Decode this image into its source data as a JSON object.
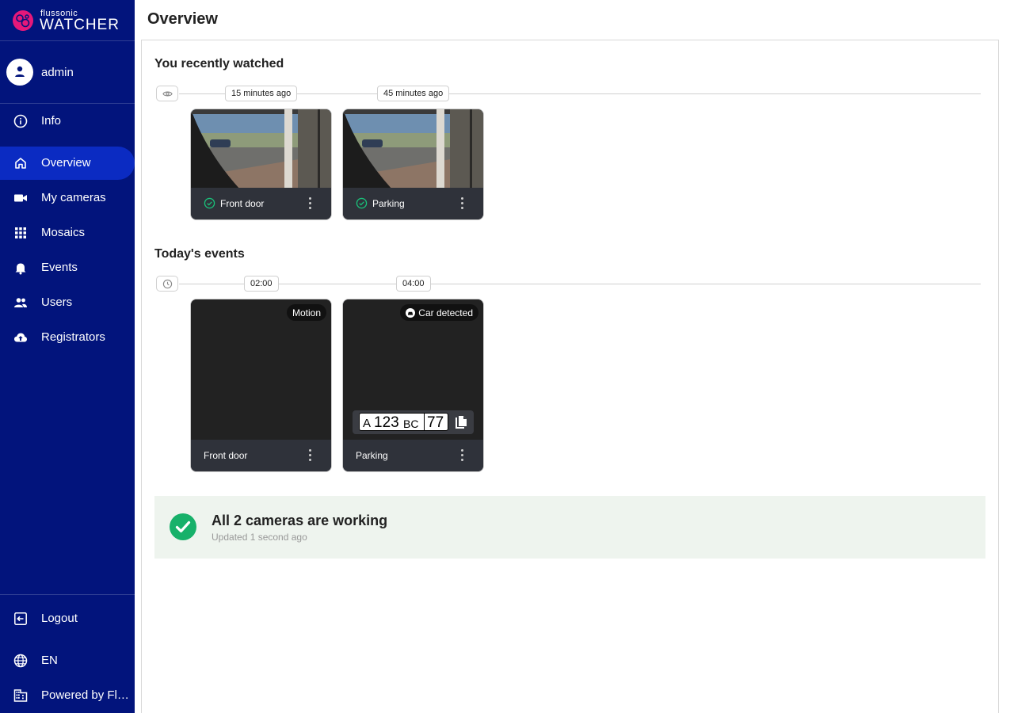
{
  "brand": {
    "small": "flussonic",
    "big": "WATCHER",
    "color": "#e6187a"
  },
  "user": {
    "name": "admin"
  },
  "nav": {
    "info": "Info",
    "overview": "Overview",
    "my_cameras": "My cameras",
    "mosaics": "Mosaics",
    "events": "Events",
    "users": "Users",
    "registrators": "Registrators",
    "logout": "Logout",
    "language": "EN",
    "powered_by": "Powered by Flussonic"
  },
  "page": {
    "title": "Overview"
  },
  "recent": {
    "title": "You recently watched",
    "labels": [
      "15 minutes ago",
      "45 minutes ago"
    ],
    "cameras": [
      {
        "name": "Front door",
        "status": "ok"
      },
      {
        "name": "Parking",
        "status": "ok"
      }
    ]
  },
  "events": {
    "title": "Today's events",
    "labels": [
      "02:00",
      "04:00"
    ],
    "items": [
      {
        "camera": "Front door",
        "badge": "Motion"
      },
      {
        "camera": "Parking",
        "badge": "Car detected",
        "plate": {
          "letter": "A",
          "number": "123",
          "series": "BC",
          "region": "77"
        }
      }
    ]
  },
  "status": {
    "title": "All 2 cameras are working",
    "updated": "Updated 1 second ago",
    "color": "#17b16a"
  },
  "colors": {
    "sidebar": "#02147c",
    "active": "#0b2bc2"
  }
}
